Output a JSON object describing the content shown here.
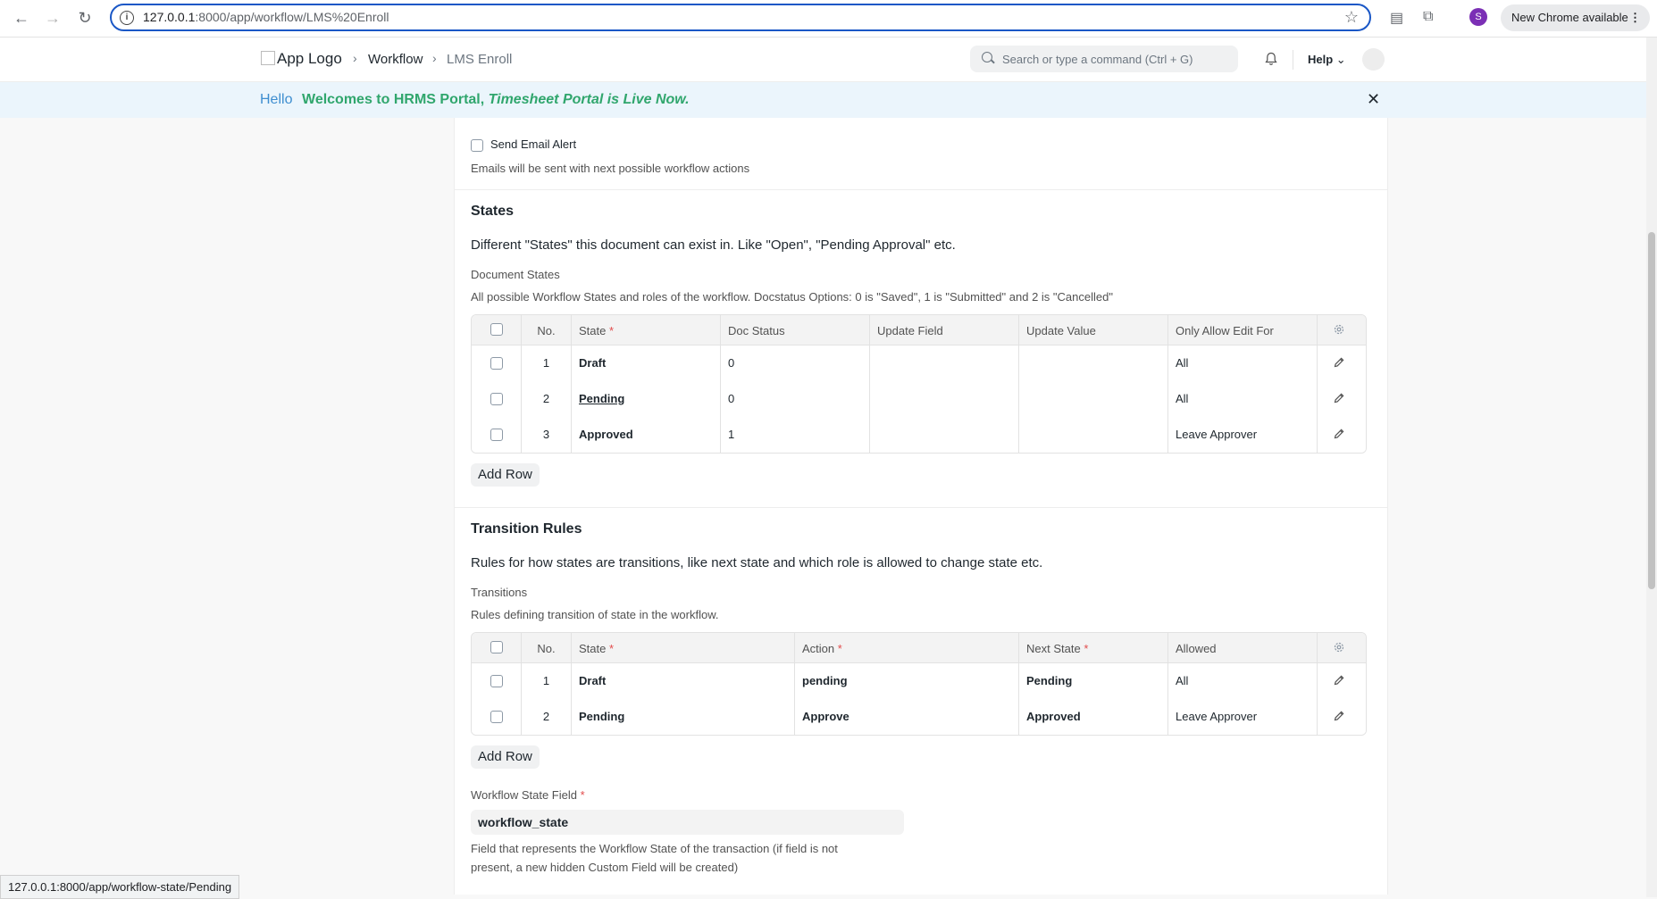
{
  "browser": {
    "url_host": "127.0.0.1",
    "url_path": ":8000/app/workflow/LMS%20Enroll",
    "profile_initial": "S",
    "new_chrome_label": "New Chrome available",
    "status_url": "127.0.0.1:8000/app/workflow-state/Pending"
  },
  "navbar": {
    "logo_alt": "App Logo",
    "breadcrumbs": [
      "Workflow",
      "LMS Enroll"
    ],
    "search_placeholder": "Search or type a command (Ctrl + G)",
    "help_label": "Help"
  },
  "banner": {
    "hello": "Hello",
    "message_bold": "Welcomes to HRMS Portal,",
    "message_italic": "Timesheet Portal is Live Now."
  },
  "email_alert": {
    "label": "Send Email Alert",
    "checked": false,
    "description": "Emails will be sent with next possible workflow actions"
  },
  "states_section": {
    "title": "States",
    "subtitle": "Different \"States\" this document can exist in. Like \"Open\", \"Pending Approval\" etc.",
    "field_label": "Document States",
    "field_description": "All possible Workflow States and roles of the workflow. Docstatus Options: 0 is \"Saved\", 1 is \"Submitted\" and 2 is \"Cancelled\"",
    "columns": [
      "No.",
      "State",
      "Doc Status",
      "Update Field",
      "Update Value",
      "Only Allow Edit For"
    ],
    "rows": [
      {
        "no": "1",
        "state": "Draft",
        "doc_status": "0",
        "update_field": "",
        "update_value": "",
        "allow_edit": "All"
      },
      {
        "no": "2",
        "state": "Pending",
        "doc_status": "0",
        "update_field": "",
        "update_value": "",
        "allow_edit": "All"
      },
      {
        "no": "3",
        "state": "Approved",
        "doc_status": "1",
        "update_field": "",
        "update_value": "",
        "allow_edit": "Leave Approver"
      }
    ],
    "add_row_label": "Add Row"
  },
  "transitions_section": {
    "title": "Transition Rules",
    "subtitle": "Rules for how states are transitions, like next state and which role is allowed to change state etc.",
    "field_label": "Transitions",
    "field_description": "Rules defining transition of state in the workflow.",
    "columns": [
      "No.",
      "State",
      "Action",
      "Next State",
      "Allowed"
    ],
    "rows": [
      {
        "no": "1",
        "state": "Draft",
        "action": "pending",
        "next_state": "Pending",
        "allowed": "All"
      },
      {
        "no": "2",
        "state": "Pending",
        "action": "Approve",
        "next_state": "Approved",
        "allowed": "Leave Approver"
      }
    ],
    "add_row_label": "Add Row"
  },
  "workflow_state_field": {
    "label": "Workflow State Field",
    "value": "workflow_state",
    "description_line1": "Field that represents the Workflow State of the transaction (if field is not",
    "description_line2": "present, a new hidden Custom Field will be created)"
  }
}
